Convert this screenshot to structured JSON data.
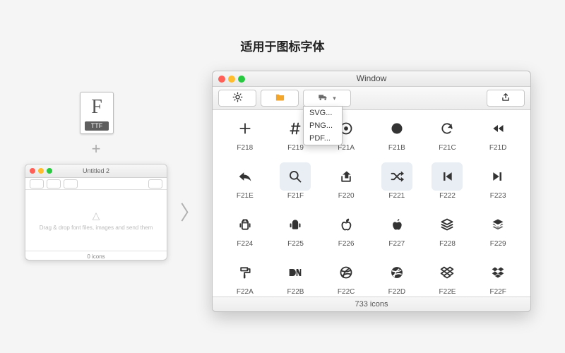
{
  "heading": "适用于图标字体",
  "ttf_label": "TTF",
  "mini_window": {
    "title": "Untitled 2",
    "hint": "Drag & drop font files, images and send them",
    "footer": "0 icons"
  },
  "window": {
    "title": "Window",
    "export_menu": [
      "SVG...",
      "PNG...",
      "PDF..."
    ],
    "icons": [
      {
        "code": "F218",
        "name": "plus-icon",
        "sel": false
      },
      {
        "code": "F219",
        "name": "hash-icon",
        "sel": false
      },
      {
        "code": "F21A",
        "name": "dot-circle-icon",
        "sel": false
      },
      {
        "code": "F21B",
        "name": "circle-icon",
        "sel": false
      },
      {
        "code": "F21C",
        "name": "refresh-icon",
        "sel": false
      },
      {
        "code": "F21D",
        "name": "rewind-icon",
        "sel": false
      },
      {
        "code": "F21E",
        "name": "reply-icon",
        "sel": false
      },
      {
        "code": "F21F",
        "name": "search-icon",
        "sel": true
      },
      {
        "code": "F220",
        "name": "share-icon",
        "sel": false
      },
      {
        "code": "F221",
        "name": "shuffle-icon",
        "sel": true
      },
      {
        "code": "F222",
        "name": "skip-back-icon",
        "sel": true
      },
      {
        "code": "F223",
        "name": "skip-forward-icon",
        "sel": false
      },
      {
        "code": "F224",
        "name": "android-outline-icon",
        "sel": false
      },
      {
        "code": "F225",
        "name": "android-icon",
        "sel": false
      },
      {
        "code": "F226",
        "name": "apple-outline-icon",
        "sel": false
      },
      {
        "code": "F227",
        "name": "apple-icon",
        "sel": false
      },
      {
        "code": "F228",
        "name": "layers-outline-icon",
        "sel": false
      },
      {
        "code": "F229",
        "name": "layers-icon",
        "sel": false
      },
      {
        "code": "F22A",
        "name": "paint-roller-icon",
        "sel": false
      },
      {
        "code": "F22B",
        "name": "designer-news-icon",
        "sel": false
      },
      {
        "code": "F22C",
        "name": "dribbble-outline-icon",
        "sel": false
      },
      {
        "code": "F22D",
        "name": "dribbble-icon",
        "sel": false
      },
      {
        "code": "F22E",
        "name": "dropbox-outline-icon",
        "sel": false
      },
      {
        "code": "F22F",
        "name": "dropbox-icon",
        "sel": false
      }
    ],
    "status": "733 icons"
  }
}
